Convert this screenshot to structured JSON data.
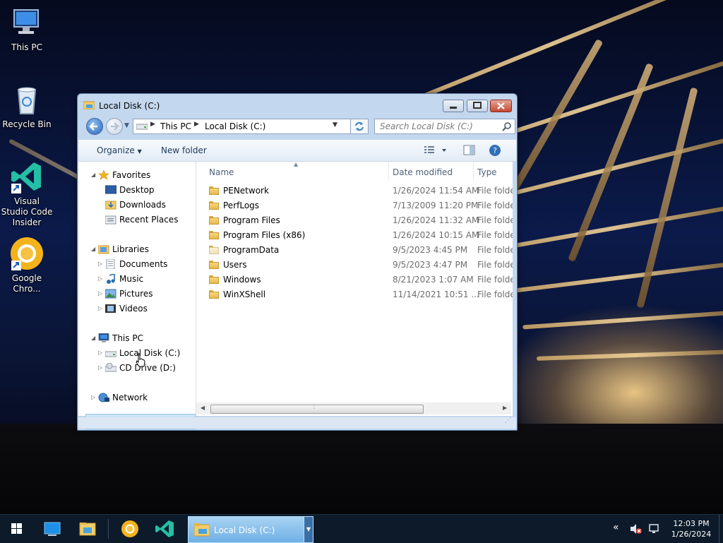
{
  "desktop": {
    "icons": [
      {
        "label": "This PC",
        "icon": "this-pc-icon"
      },
      {
        "label": "Recycle Bin",
        "icon": "recycle-bin-icon"
      },
      {
        "label": "Visual Studio Code Insider",
        "icon": "vscode-insider-icon"
      },
      {
        "label": "Google Chro...",
        "icon": "chrome-icon"
      }
    ]
  },
  "window": {
    "title": "Local Disk (C:)",
    "breadcrumb": [
      "This PC",
      "Local Disk (C:)"
    ],
    "search_placeholder": "Search Local Disk (C:)",
    "commands": {
      "organize": "Organize",
      "new_folder": "New folder"
    },
    "nav": {
      "favorites": {
        "label": "Favorites",
        "items": [
          "Desktop",
          "Downloads",
          "Recent Places"
        ]
      },
      "libraries": {
        "label": "Libraries",
        "items": [
          "Documents",
          "Music",
          "Pictures",
          "Videos"
        ]
      },
      "this_pc": {
        "label": "This PC",
        "items": [
          "Local Disk (C:)",
          "CD Drive (D:)"
        ]
      },
      "network": {
        "label": "Network"
      }
    },
    "columns": {
      "name": "Name",
      "date": "Date modified",
      "type": "Type"
    },
    "files": [
      {
        "name": "PENetwork",
        "date": "1/26/2024 11:54 AM",
        "type": "File folder"
      },
      {
        "name": "PerfLogs",
        "date": "7/13/2009 11:20 PM",
        "type": "File folder"
      },
      {
        "name": "Program Files",
        "date": "1/26/2024 11:32 AM",
        "type": "File folder"
      },
      {
        "name": "Program Files (x86)",
        "date": "1/26/2024 10:15 AM",
        "type": "File folder"
      },
      {
        "name": "ProgramData",
        "date": "9/5/2023 4:45 PM",
        "type": "File folder"
      },
      {
        "name": "Users",
        "date": "9/5/2023 4:47 PM",
        "type": "File folder"
      },
      {
        "name": "Windows",
        "date": "8/21/2023 1:07 AM",
        "type": "File folder"
      },
      {
        "name": "WinXShell",
        "date": "11/14/2021 10:51 ...",
        "type": "File folder"
      }
    ]
  },
  "taskbar": {
    "active_window": "Local Disk (C:)",
    "time": "12:03 PM",
    "date": "1/26/2024"
  },
  "colors": {
    "accent": "#2b66b8",
    "selection": "#cce4f7",
    "taskbar": "#0c1a2a"
  }
}
